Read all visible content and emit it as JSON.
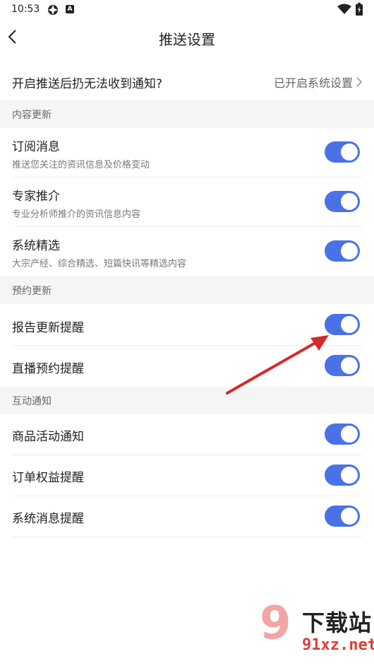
{
  "status_bar": {
    "time": "10:53",
    "app_badge": "A"
  },
  "header": {
    "title": "推送设置"
  },
  "notice": {
    "label": "开启推送后扔无法收到通知?",
    "action_label": "已开启系统设置"
  },
  "sections": {
    "content": {
      "title": "内容更新",
      "items": [
        {
          "title": "订阅消息",
          "subtitle": "推送您关注的资讯信息及价格变动",
          "enabled": true
        },
        {
          "title": "专家推介",
          "subtitle": "专业分析师推介的资讯信息内容",
          "enabled": true
        },
        {
          "title": "系统精选",
          "subtitle": "大宗产经、综合精选、短篇快讯等精选内容",
          "enabled": true
        }
      ]
    },
    "reservation": {
      "title": "预约更新",
      "items": [
        {
          "title": "报告更新提醒",
          "enabled": true
        },
        {
          "title": "直播预约提醒",
          "enabled": true
        }
      ]
    },
    "interaction": {
      "title": "互动通知",
      "items": [
        {
          "title": "商品活动通知",
          "enabled": true
        },
        {
          "title": "订单权益提醒",
          "enabled": true
        },
        {
          "title": "系统消息提醒",
          "enabled": true
        }
      ]
    }
  },
  "watermark": {
    "number": "9",
    "brand": "下载站",
    "url": "91xz.net"
  },
  "colors": {
    "toggle_on": "#4a72e6",
    "section_bg": "#f5f5f5",
    "arrow": "#d42a2a"
  }
}
